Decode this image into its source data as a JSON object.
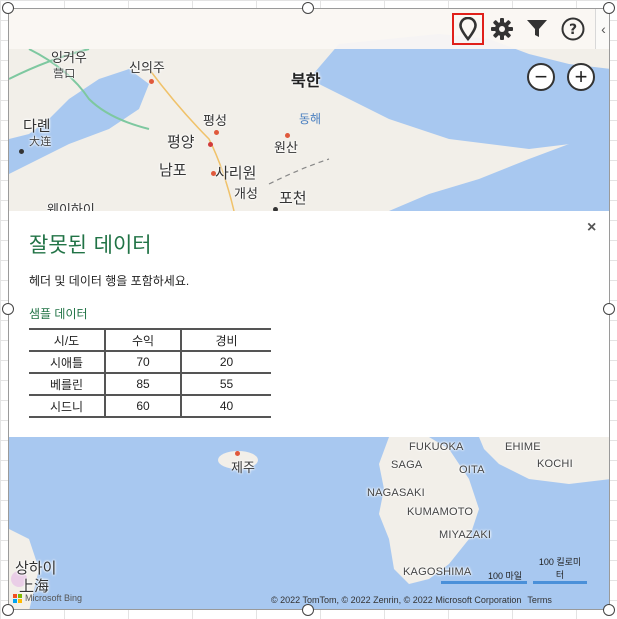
{
  "toolbar": {
    "pin_icon": "map-pin-icon",
    "gear_icon": "gear-icon",
    "filter_icon": "filter-icon",
    "help_icon": "help-icon",
    "collapse_label": "‹"
  },
  "zoom": {
    "out_label": "−",
    "in_label": "+"
  },
  "map": {
    "labels": {
      "yingkou": "잉커우",
      "yingkou_cn": "营口",
      "sinuiju": "신의주",
      "north_korea": "북한",
      "dalian": "다롄",
      "dalian_cn": "大连",
      "pyongsong": "평성",
      "pyongyang": "평양",
      "east_sea": "동해",
      "wonsan": "원산",
      "nampo": "남포",
      "sariwon": "사리원",
      "kaesong": "개성",
      "pocheon": "포천",
      "weihai": "웨이하이",
      "jeju": "제주",
      "fukuoka": "FUKUOKA",
      "ehime": "EHIME",
      "kochi": "KOCHI",
      "saga": "SAGA",
      "oita": "OITA",
      "nagasaki": "NAGASAKI",
      "kumamoto": "KUMAMOTO",
      "miyazaki": "MIYAZAKI",
      "kagoshima": "KAGOSHIMA",
      "shanghai": "상하이",
      "shanghai_cn": "上海"
    }
  },
  "panel": {
    "close_label": "×",
    "title": "잘못된 데이터",
    "message": "헤더 및 데이터 행을 포함하세요.",
    "sample_label": "샘플 데이터",
    "table": {
      "headers": [
        "시/도",
        "수익",
        "경비"
      ],
      "rows": [
        [
          "시애틀",
          "70",
          "20"
        ],
        [
          "베를린",
          "85",
          "55"
        ],
        [
          "시드니",
          "60",
          "40"
        ]
      ]
    }
  },
  "footer": {
    "bing_label": "Microsoft Bing",
    "copyright": "© 2022 TomTom, © 2022 Zenrin, © 2022 Microsoft Corporation",
    "terms": "Terms",
    "scale_miles": "100 마일",
    "scale_km": "100 킬로미터"
  },
  "colors": {
    "accent": "#217346",
    "highlight": "#e0201a",
    "water": "#a8c8f0",
    "land": "#f2efe9"
  }
}
